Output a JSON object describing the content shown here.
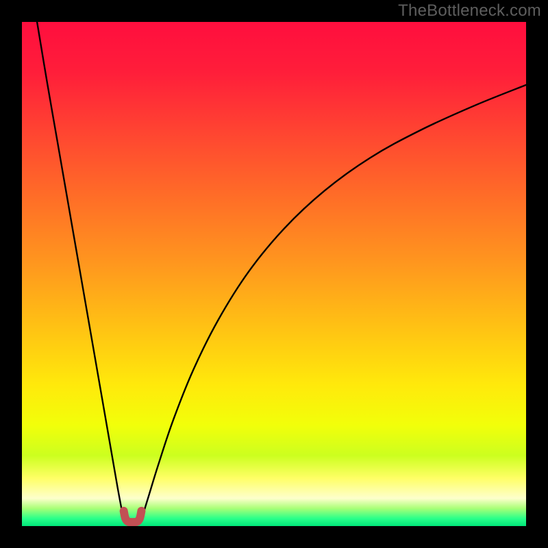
{
  "attribution": "TheBottleneck.com",
  "chart_data": {
    "type": "line",
    "title": "",
    "xlabel": "",
    "ylabel": "",
    "xlim": [
      0,
      100
    ],
    "ylim": [
      0,
      100
    ],
    "grid": false,
    "legend": false,
    "series": [
      {
        "name": "left-branch",
        "x": [
          3,
          5,
          7,
          9,
          11,
          13,
          15,
          17,
          19,
          20.2,
          20.8,
          21.3
        ],
        "y": [
          100,
          88,
          76.5,
          65,
          53.5,
          42,
          30.5,
          19,
          7.5,
          1.4,
          0.6,
          0.6
        ]
      },
      {
        "name": "right-branch",
        "x": [
          22.6,
          23.1,
          23.7,
          25,
          27,
          30,
          34,
          39,
          45,
          52,
          60,
          69,
          79,
          90,
          100
        ],
        "y": [
          0.6,
          0.6,
          1.4,
          5.5,
          12,
          21,
          31,
          41,
          50.5,
          59,
          66.5,
          73,
          78.5,
          83.5,
          87.5
        ]
      },
      {
        "name": "trough-marker",
        "x": [
          20.2,
          20.5,
          21.0,
          21.6,
          22.2,
          22.9,
          23.4,
          23.7
        ],
        "y": [
          3.0,
          1.6,
          0.9,
          0.8,
          0.8,
          0.9,
          1.6,
          3.0
        ]
      }
    ],
    "background_gradient": {
      "stops": [
        {
          "offset": 0.0,
          "color": "#ff0e3e"
        },
        {
          "offset": 0.1,
          "color": "#ff1e3a"
        },
        {
          "offset": 0.22,
          "color": "#ff4531"
        },
        {
          "offset": 0.35,
          "color": "#ff6e27"
        },
        {
          "offset": 0.48,
          "color": "#ff971e"
        },
        {
          "offset": 0.6,
          "color": "#ffc014"
        },
        {
          "offset": 0.72,
          "color": "#ffe90b"
        },
        {
          "offset": 0.8,
          "color": "#f2ff0a"
        },
        {
          "offset": 0.86,
          "color": "#ccff1f"
        },
        {
          "offset": 0.905,
          "color": "#ffff66"
        },
        {
          "offset": 0.945,
          "color": "#fdffcc"
        },
        {
          "offset": 0.965,
          "color": "#a8ff77"
        },
        {
          "offset": 0.985,
          "color": "#2aff8a"
        },
        {
          "offset": 1.0,
          "color": "#00e67a"
        }
      ]
    },
    "curve_stroke": "#000000",
    "marker_stroke": "#c25054"
  }
}
